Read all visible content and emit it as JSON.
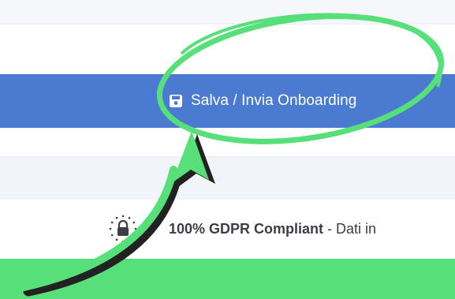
{
  "toolbar": {
    "save_label": "Salva / Invia Onboarding",
    "save_icon": "floppy-disk-icon"
  },
  "compliance": {
    "strong_text": "100% GDPR Compliant",
    "rest_text": "- Dati in",
    "icon": "eu-stars-padlock-icon"
  },
  "annotation": {
    "highlight_color": "#57e07a",
    "arrow_color": "#57e07a"
  },
  "colors": {
    "save_bar": "#4a7bd0",
    "footer": "#57e07a"
  }
}
